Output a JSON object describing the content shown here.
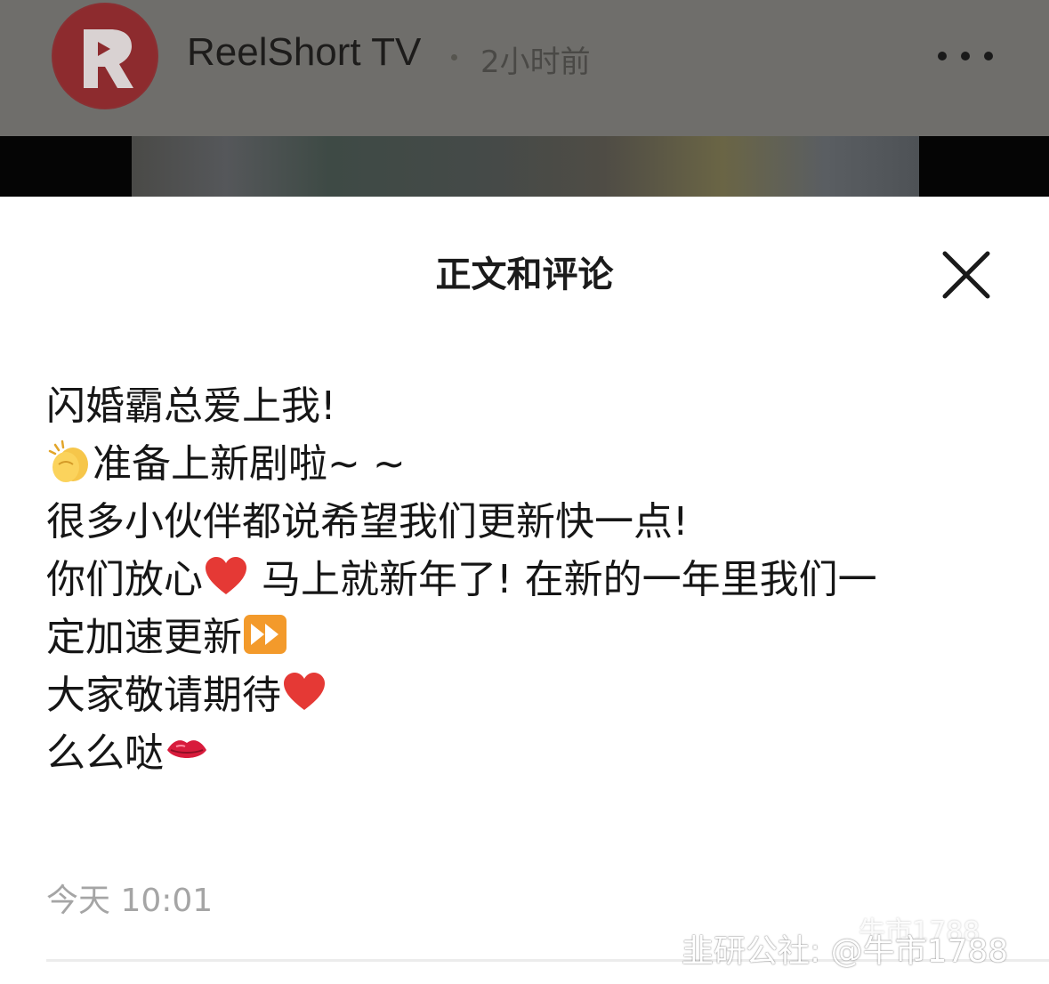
{
  "background_post": {
    "account_name": "ReelShort TV",
    "post_time": "2小时前",
    "logo_letter": "R"
  },
  "sheet": {
    "title": "正文和评论",
    "post_lines": [
      "闪婚霸总爱上我!",
      "准备上新剧啦~ ~",
      "很多小伙伴都说希望我们更新快一点!",
      "你们放心",
      " 马上就新年了! 在新的一年里我们一",
      "定加速更新",
      "大家敬请期待",
      "么么哒"
    ],
    "emoji_icons": [
      "clapping-hands-icon",
      "red-heart-icon",
      "fast-forward-icon",
      "red-heart-icon",
      "kiss-mark-icon"
    ],
    "timestamp": "今天 10:01"
  },
  "watermark": {
    "text": "韭研公社: @牛市1788",
    "ghost_text": "牛市1788"
  },
  "colors": {
    "logo_red": "#c8242c",
    "heart_red": "#e53935",
    "ff_orange": "#f39a2b",
    "dim_overlay": "#6f6e6b"
  }
}
